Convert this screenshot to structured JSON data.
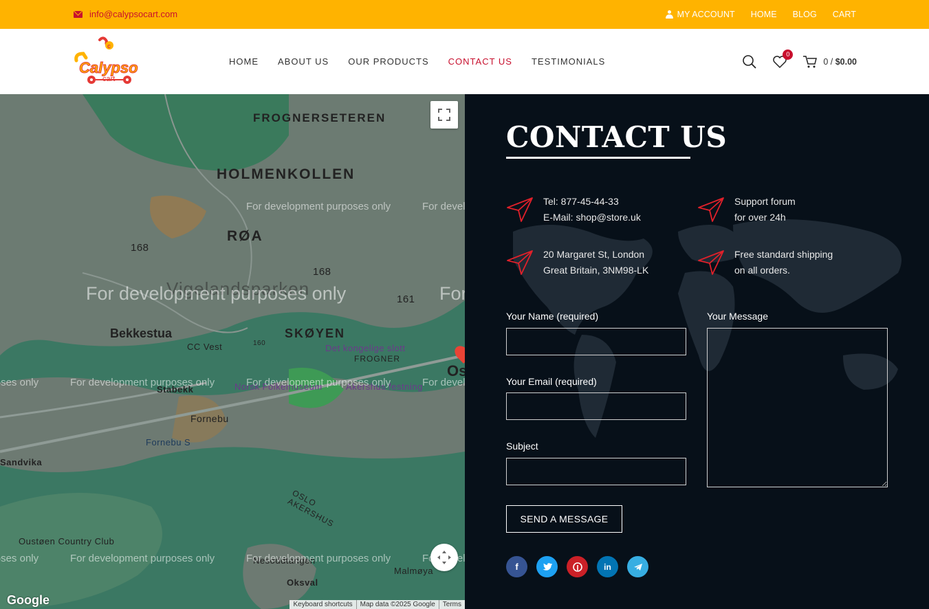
{
  "topbar": {
    "email": "info@calypsocart.com",
    "nav": [
      "My Account",
      "Home",
      "Blog",
      "Cart"
    ],
    "colors": {
      "bg": "#ffb300",
      "accent": "#c8102e"
    }
  },
  "header": {
    "logo_text": "Calypso",
    "logo_sub": "cart",
    "nav": [
      "Home",
      "About Us",
      "Our Products",
      "Contact Us",
      "Testimonials"
    ],
    "active": "Contact Us",
    "wishlist_count": "0",
    "cart_count": "0",
    "cart_total": "$0.00"
  },
  "map": {
    "labels": {
      "frognerseteren": "FROGNERSETEREN",
      "holmenkollen": "HOLMENKOLLEN",
      "roa": "RØA",
      "vigelandsparken": "Vigelandsparken",
      "bekkestua": "Bekkestua",
      "skoyen": "SKØYEN",
      "cc_vest": "CC Vest",
      "kongelige": "Det kongelige slott",
      "frogner": "FROGNER",
      "stabekk": "Stabekk",
      "folkemuseum": "Norsk Folkemuseum",
      "akershus_festning": "Akershus festning",
      "fornebu": "Fornebu",
      "fornebu_s": "Fornebu S",
      "sandvika": "Sandvika",
      "oslo_akershus": "OSLO AKERSHUS",
      "oustoen": "Oustøen Country Club",
      "nesodden": "Nesoddtangen",
      "oksval": "Oksval",
      "malmoya": "Malmøya",
      "oslo_partial": "Os",
      "road_168a": "168",
      "road_168b": "168",
      "road_161": "161",
      "road_160": "160"
    },
    "watermark": "For development purposes only",
    "google": "Google",
    "attribution": [
      "Keyboard shortcuts",
      "Map data ©2025 Google",
      "Terms"
    ]
  },
  "contact": {
    "title": "CONTACT US",
    "info": [
      {
        "line1": "Tel: 877-45-44-33",
        "line2": "E-Mail: shop@store.uk"
      },
      {
        "line1": "Support forum",
        "line2": "for over 24h"
      },
      {
        "line1": "20 Margaret St, London",
        "line2": "Great Britain, 3NM98-LK"
      },
      {
        "line1": "Free standard shipping",
        "line2": "on all orders."
      }
    ],
    "form": {
      "name_label": "Your Name (required)",
      "email_label": "Your Email (required)",
      "subject_label": "Subject",
      "message_label": "Your Message",
      "submit": "SEND A MESSAGE"
    },
    "socials": [
      "facebook",
      "twitter",
      "pinterest",
      "linkedin",
      "telegram"
    ]
  }
}
